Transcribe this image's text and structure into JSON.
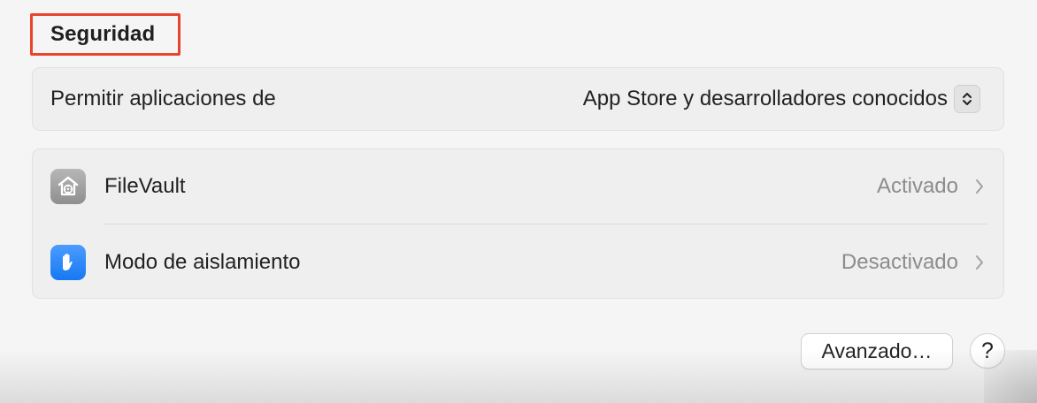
{
  "security": {
    "title": "Seguridad"
  },
  "allow_apps": {
    "label": "Permitir aplicaciones de",
    "selected_value": "App Store y desarrolladores conocidos"
  },
  "items": [
    {
      "label": "FileVault",
      "status": "Activado",
      "icon": "filevault-icon"
    },
    {
      "label": "Modo de aislamiento",
      "status": "Desactivado",
      "icon": "lockdown-hand-icon"
    }
  ],
  "footer": {
    "advanced_label": "Avanzado…",
    "help_label": "?"
  },
  "colors": {
    "highlight_border": "#e8442e",
    "filevault_icon_bg": "#a3a3a3",
    "lockdown_icon_bg": "#2b88f7"
  }
}
